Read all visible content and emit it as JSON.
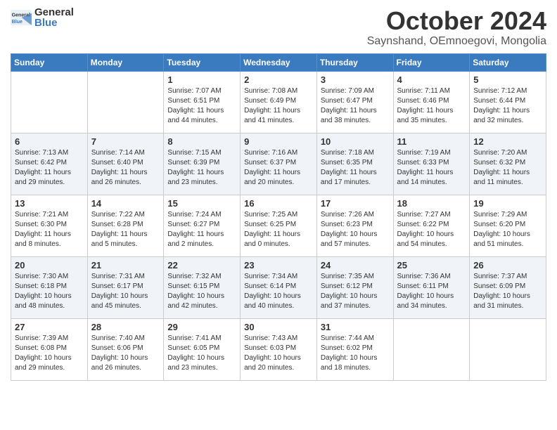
{
  "logo": {
    "general": "General",
    "blue": "Blue"
  },
  "header": {
    "month": "October 2024",
    "location": "Saynshand, OEmnoegovi, Mongolia"
  },
  "weekdays": [
    "Sunday",
    "Monday",
    "Tuesday",
    "Wednesday",
    "Thursday",
    "Friday",
    "Saturday"
  ],
  "weeks": [
    [
      {
        "day": "",
        "info": ""
      },
      {
        "day": "",
        "info": ""
      },
      {
        "day": "1",
        "info": "Sunrise: 7:07 AM\nSunset: 6:51 PM\nDaylight: 11 hours and 44 minutes."
      },
      {
        "day": "2",
        "info": "Sunrise: 7:08 AM\nSunset: 6:49 PM\nDaylight: 11 hours and 41 minutes."
      },
      {
        "day": "3",
        "info": "Sunrise: 7:09 AM\nSunset: 6:47 PM\nDaylight: 11 hours and 38 minutes."
      },
      {
        "day": "4",
        "info": "Sunrise: 7:11 AM\nSunset: 6:46 PM\nDaylight: 11 hours and 35 minutes."
      },
      {
        "day": "5",
        "info": "Sunrise: 7:12 AM\nSunset: 6:44 PM\nDaylight: 11 hours and 32 minutes."
      }
    ],
    [
      {
        "day": "6",
        "info": "Sunrise: 7:13 AM\nSunset: 6:42 PM\nDaylight: 11 hours and 29 minutes."
      },
      {
        "day": "7",
        "info": "Sunrise: 7:14 AM\nSunset: 6:40 PM\nDaylight: 11 hours and 26 minutes."
      },
      {
        "day": "8",
        "info": "Sunrise: 7:15 AM\nSunset: 6:39 PM\nDaylight: 11 hours and 23 minutes."
      },
      {
        "day": "9",
        "info": "Sunrise: 7:16 AM\nSunset: 6:37 PM\nDaylight: 11 hours and 20 minutes."
      },
      {
        "day": "10",
        "info": "Sunrise: 7:18 AM\nSunset: 6:35 PM\nDaylight: 11 hours and 17 minutes."
      },
      {
        "day": "11",
        "info": "Sunrise: 7:19 AM\nSunset: 6:33 PM\nDaylight: 11 hours and 14 minutes."
      },
      {
        "day": "12",
        "info": "Sunrise: 7:20 AM\nSunset: 6:32 PM\nDaylight: 11 hours and 11 minutes."
      }
    ],
    [
      {
        "day": "13",
        "info": "Sunrise: 7:21 AM\nSunset: 6:30 PM\nDaylight: 11 hours and 8 minutes."
      },
      {
        "day": "14",
        "info": "Sunrise: 7:22 AM\nSunset: 6:28 PM\nDaylight: 11 hours and 5 minutes."
      },
      {
        "day": "15",
        "info": "Sunrise: 7:24 AM\nSunset: 6:27 PM\nDaylight: 11 hours and 2 minutes."
      },
      {
        "day": "16",
        "info": "Sunrise: 7:25 AM\nSunset: 6:25 PM\nDaylight: 11 hours and 0 minutes."
      },
      {
        "day": "17",
        "info": "Sunrise: 7:26 AM\nSunset: 6:23 PM\nDaylight: 10 hours and 57 minutes."
      },
      {
        "day": "18",
        "info": "Sunrise: 7:27 AM\nSunset: 6:22 PM\nDaylight: 10 hours and 54 minutes."
      },
      {
        "day": "19",
        "info": "Sunrise: 7:29 AM\nSunset: 6:20 PM\nDaylight: 10 hours and 51 minutes."
      }
    ],
    [
      {
        "day": "20",
        "info": "Sunrise: 7:30 AM\nSunset: 6:18 PM\nDaylight: 10 hours and 48 minutes."
      },
      {
        "day": "21",
        "info": "Sunrise: 7:31 AM\nSunset: 6:17 PM\nDaylight: 10 hours and 45 minutes."
      },
      {
        "day": "22",
        "info": "Sunrise: 7:32 AM\nSunset: 6:15 PM\nDaylight: 10 hours and 42 minutes."
      },
      {
        "day": "23",
        "info": "Sunrise: 7:34 AM\nSunset: 6:14 PM\nDaylight: 10 hours and 40 minutes."
      },
      {
        "day": "24",
        "info": "Sunrise: 7:35 AM\nSunset: 6:12 PM\nDaylight: 10 hours and 37 minutes."
      },
      {
        "day": "25",
        "info": "Sunrise: 7:36 AM\nSunset: 6:11 PM\nDaylight: 10 hours and 34 minutes."
      },
      {
        "day": "26",
        "info": "Sunrise: 7:37 AM\nSunset: 6:09 PM\nDaylight: 10 hours and 31 minutes."
      }
    ],
    [
      {
        "day": "27",
        "info": "Sunrise: 7:39 AM\nSunset: 6:08 PM\nDaylight: 10 hours and 29 minutes."
      },
      {
        "day": "28",
        "info": "Sunrise: 7:40 AM\nSunset: 6:06 PM\nDaylight: 10 hours and 26 minutes."
      },
      {
        "day": "29",
        "info": "Sunrise: 7:41 AM\nSunset: 6:05 PM\nDaylight: 10 hours and 23 minutes."
      },
      {
        "day": "30",
        "info": "Sunrise: 7:43 AM\nSunset: 6:03 PM\nDaylight: 10 hours and 20 minutes."
      },
      {
        "day": "31",
        "info": "Sunrise: 7:44 AM\nSunset: 6:02 PM\nDaylight: 10 hours and 18 minutes."
      },
      {
        "day": "",
        "info": ""
      },
      {
        "day": "",
        "info": ""
      }
    ]
  ]
}
